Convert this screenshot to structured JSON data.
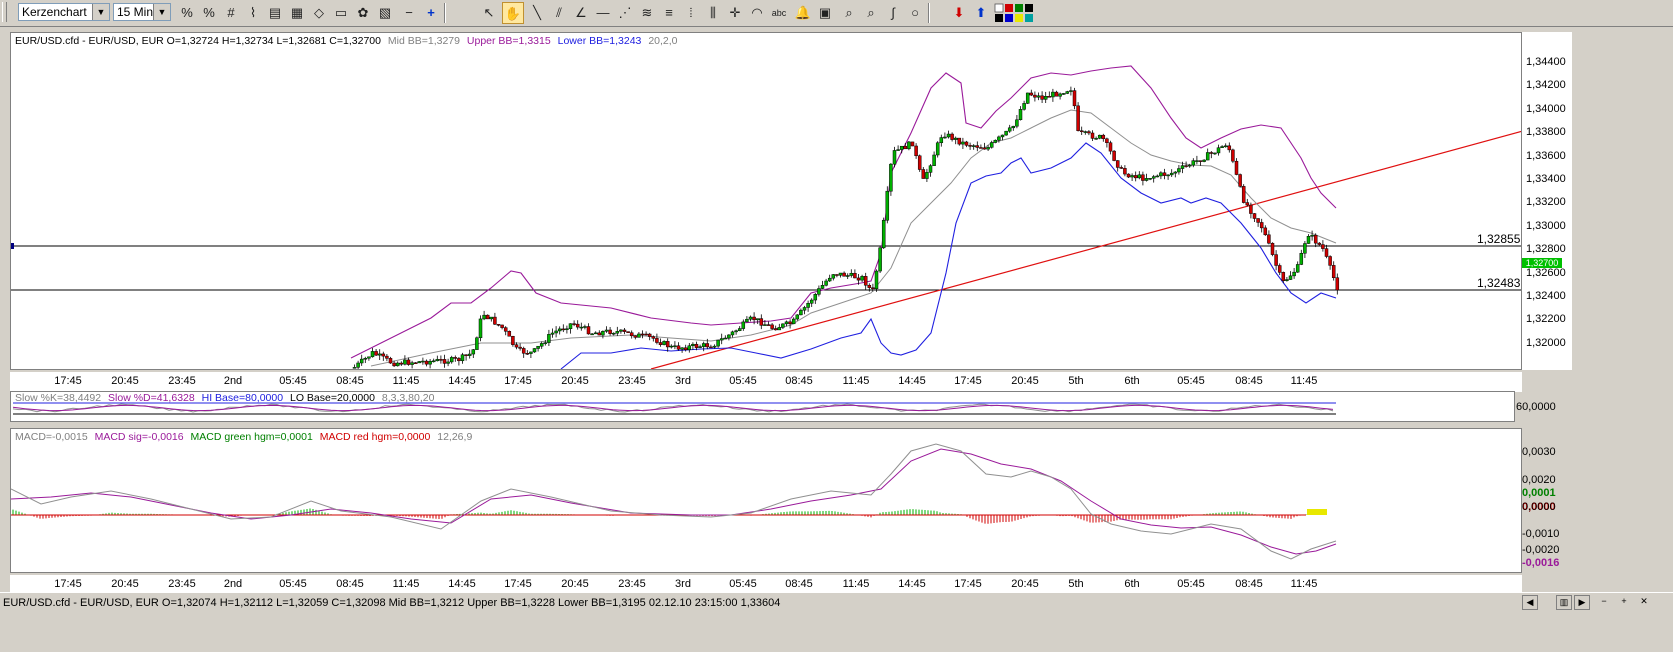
{
  "toolbar": {
    "chart_type": "Kerzenchart",
    "interval": "15 Min."
  },
  "main_chart": {
    "legend_ohlc": "EUR/USD.cfd - EUR/USD, EUR O=1,32724 H=1,32734 L=1,32681 C=1,32700",
    "legend_mid": "Mid BB=1,3279",
    "legend_upper": "Upper BB=1,3315",
    "legend_lower": "Lower BB=1,3243",
    "legend_params": "20,2,0",
    "y_ticks": [
      "1,34400",
      "1,34200",
      "1,34000",
      "1,33800",
      "1,33600",
      "1,33400",
      "1,33200",
      "1,33000",
      "1,32800",
      "1,32600",
      "1,32400",
      "1,32200",
      "1,32000"
    ],
    "hline_upper": "1,32855",
    "hline_lower": "1,32483",
    "last_price": "1,32700"
  },
  "time_labels": [
    "17:45",
    "20:45",
    "23:45",
    "2nd",
    "05:45",
    "08:45",
    "11:45",
    "14:45",
    "17:45",
    "20:45",
    "23:45",
    "3rd",
    "05:45",
    "08:45",
    "11:45",
    "14:45",
    "17:45",
    "20:45",
    "5th",
    "6th",
    "05:45",
    "08:45",
    "11:45"
  ],
  "stoch": {
    "legend_k": "Slow %K=38,4492",
    "legend_d": "Slow %D=41,6328",
    "legend_hi": "HI Base=80,0000",
    "legend_lo": "LO Base=20,0000",
    "legend_params": "8,3,3,80,20",
    "y_tick": "60,0000"
  },
  "macd": {
    "legend_macd": "MACD=-0,0015",
    "legend_sig": "MACD sig=-0,0016",
    "legend_green": "MACD green hgm=0,0001",
    "legend_red": "MACD red hgm=0,0000",
    "legend_params": "12,26,9",
    "y_ticks": [
      "0,0030",
      "0,0020",
      "0,0010",
      "0,0000",
      "-0,0010",
      "-0,0020"
    ],
    "val_green": "0,0001",
    "val_zero": "0,0000",
    "val_sig": "-0,0016"
  },
  "status": {
    "text": "EUR/USD.cfd - EUR/USD, EUR O=1,32074 H=1,32112 L=1,32059 C=1,32098  Mid BB=1,3212 Upper BB=1,3228 Lower BB=1,3195  02.12.10 23:15:00 1,33604"
  },
  "colors": {
    "upper_bb": "#9a1a9a",
    "lower_bb": "#2020e0",
    "mid_bb": "#909090",
    "trend": "#e01010",
    "bull": "#00b000",
    "bear": "#d00000"
  }
}
